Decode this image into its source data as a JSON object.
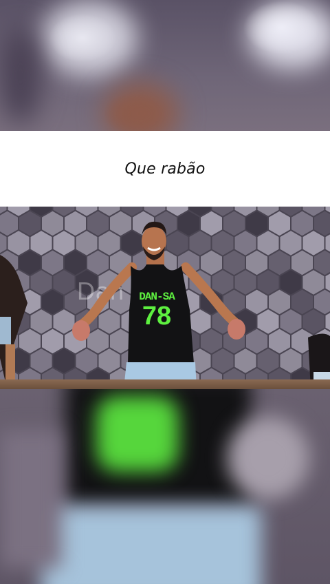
{
  "caption": {
    "text": "Que rabão"
  },
  "video": {
    "watermark": "Dan fit.br",
    "shirt_brand": "DAN-SA",
    "shirt_number": "78"
  },
  "colors": {
    "caption_bg": "#ffffff",
    "shirt": "#121214",
    "shirt_print": "#5ef040",
    "jeans": "#a9c9e3"
  }
}
